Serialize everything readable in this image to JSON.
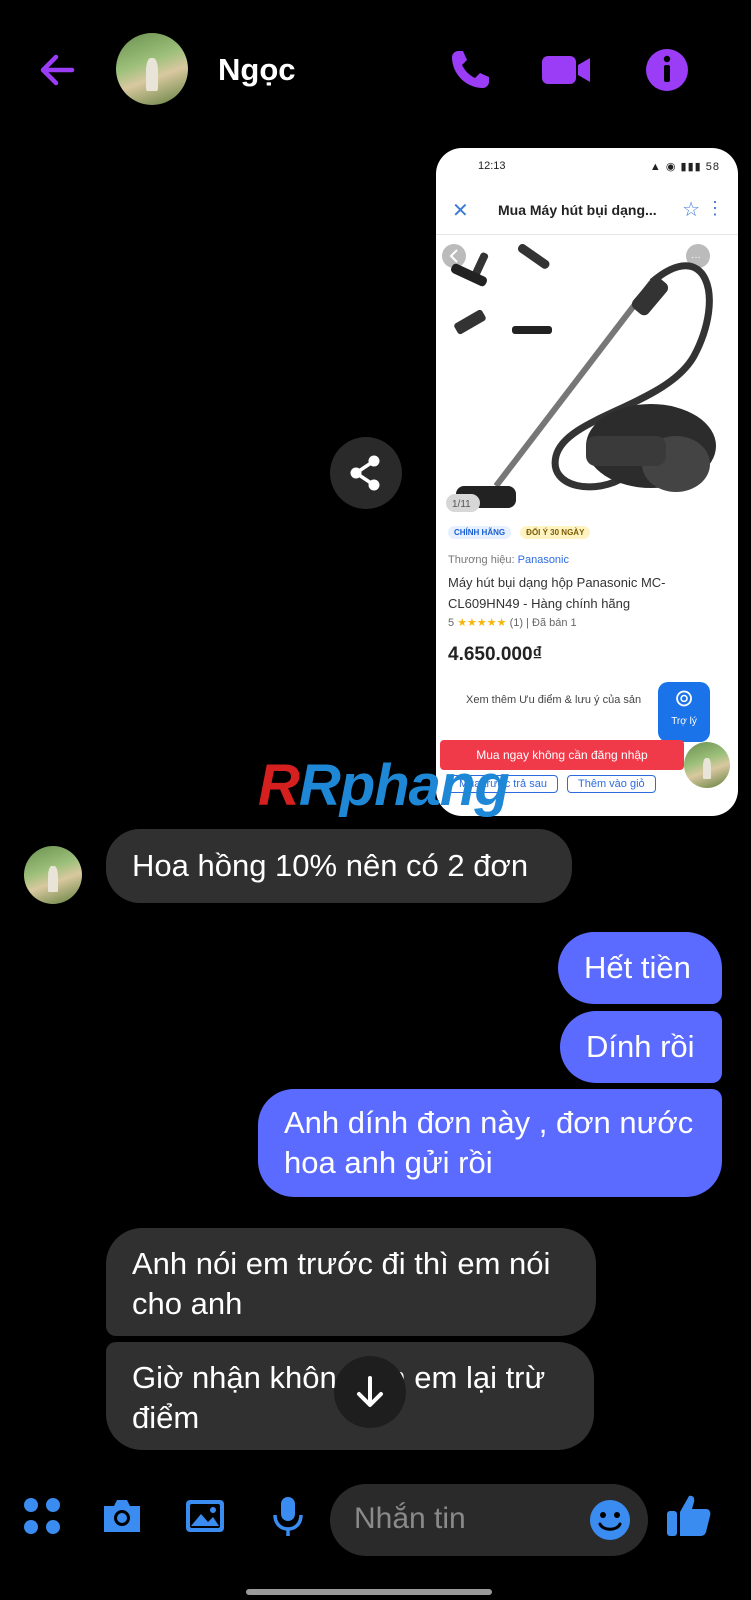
{
  "header": {
    "contact_name": "Ngọc",
    "back_icon": "arrow-left-icon",
    "call_icon": "phone-icon",
    "video_icon": "video-camera-icon",
    "info_icon": "info-icon",
    "accent_color": "#9b3cf6"
  },
  "shared_screenshot": {
    "status_time": "12:13",
    "status_battery": "58",
    "page_title": "Mua Máy hút bụi dạng...",
    "image_counter": "1/11",
    "badge_genuine": "CHÍNH HÃNG",
    "badge_return": "ĐỔI Ý 30 NGÀY",
    "brand_label": "Thương hiệu:",
    "brand_name": "Panasonic",
    "product_name": "Máy hút bụi dạng hộp Panasonic MC-CL609HN49 - Hàng chính hãng",
    "rating_value": "5",
    "rating_count": "(1)",
    "sold": "Đã bán 1",
    "price": "4.650.000₫",
    "more_info": "Xem thêm Ưu điểm & lưu ý của sản",
    "assistant_label": "Trợ lý",
    "buy_button": "Mua ngay không cần đăng nhập",
    "pay_later": "Mua trước trả sau",
    "add_to_cart": "Thêm vào giỏ"
  },
  "watermark": "Rphang",
  "messages": [
    {
      "side": "in",
      "text": "Hoa hồng 10% nên có 2 đơn"
    },
    {
      "side": "out",
      "text": "Hết tiền"
    },
    {
      "side": "out",
      "text": "Dính rồi"
    },
    {
      "side": "out",
      "text": "Anh dính đơn này , đơn nước hoa anh gửi rồi"
    },
    {
      "side": "in",
      "text": "Anh nói em trước đi thì em nói cho anh"
    },
    {
      "side": "in",
      "text": "Giờ nhận không em em lại trừ điểm"
    }
  ],
  "composer": {
    "placeholder": "Nhắn tin",
    "menu_icon": "grid-dots-icon",
    "camera_icon": "camera-icon",
    "gallery_icon": "image-icon",
    "mic_icon": "microphone-icon",
    "emoji_icon": "emoji-icon",
    "like_icon": "thumbs-up-icon",
    "tool_color": "#3b8cf0"
  }
}
